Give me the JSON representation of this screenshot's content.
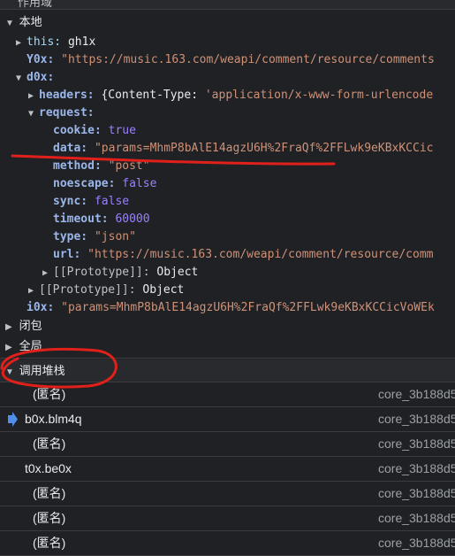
{
  "scope": {
    "header": "作用域",
    "local_label": "本地",
    "closure_label": "闭包",
    "global_label": "全局",
    "call_stack_label": "调用堆栈"
  },
  "vars": {
    "this_key": "this:",
    "this_val": "gh1x",
    "y0x_key": "Y0x:",
    "y0x_val": "\"https://music.163.com/weapi/comment/resource/comments",
    "d0x_key": "d0x:",
    "headers_key": "headers:",
    "headers_val_open": "{Content-Type: ",
    "headers_val_str": "'application/x-www-form-urlencode",
    "request_key": "request:",
    "cookie_key": "cookie:",
    "cookie_val": "true",
    "data_key": "data:",
    "data_val": "\"params=MhmP8bAlE14agzU6H%2FraQf%2FFLwk9eKBxKCCic",
    "method_key": "method:",
    "method_val": "\"post\"",
    "noescape_key": "noescape:",
    "noescape_val": "false",
    "sync_key": "sync:",
    "sync_val": "false",
    "timeout_key": "timeout:",
    "timeout_val": "60000",
    "type_key": "type:",
    "type_val": "\"json\"",
    "url_key": "url:",
    "url_val": "\"https://music.163.com/weapi/comment/resource/comm",
    "proto_label": "[[Prototype]]:",
    "proto_val": "Object",
    "i0x_key": "i0x:",
    "i0x_val": "\"params=MhmP8bAlE14agzU6H%2FraQf%2FFLwk9eKBxKCCicVoWEk"
  },
  "call_stack": [
    {
      "fn": "(匿名)",
      "loc": "core_3b188d5",
      "current": false
    },
    {
      "fn": "b0x.blm4q",
      "loc": "core_3b188d5",
      "current": true
    },
    {
      "fn": "(匿名)",
      "loc": "core_3b188d5",
      "current": false
    },
    {
      "fn": "t0x.be0x",
      "loc": "core_3b188d5",
      "current": false
    },
    {
      "fn": "(匿名)",
      "loc": "core_3b188d5",
      "current": false
    },
    {
      "fn": "(匿名)",
      "loc": "core_3b188d5",
      "current": false
    },
    {
      "fn": "(匿名)",
      "loc": "core_3b188d5",
      "current": false
    }
  ],
  "colors": {
    "annotation": "#e0201b",
    "current_frame_arrow": "#4f8fea"
  }
}
